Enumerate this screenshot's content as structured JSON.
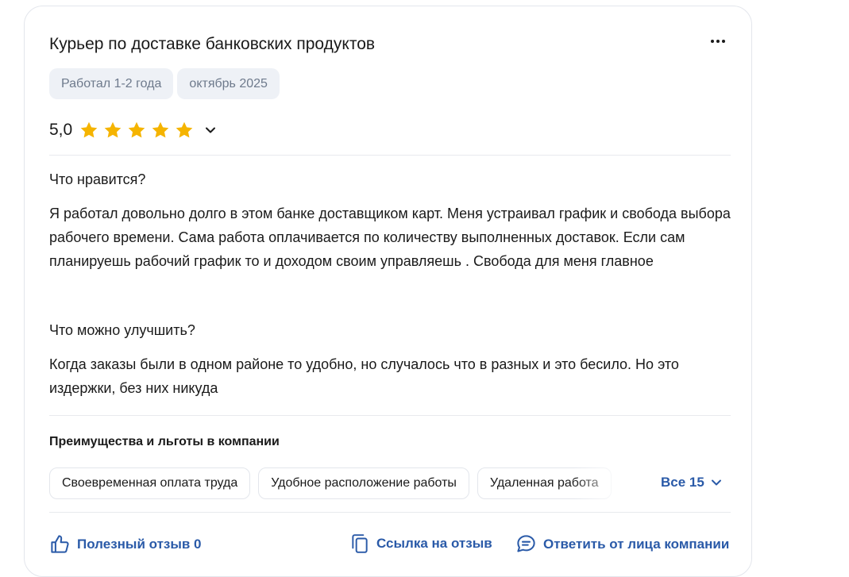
{
  "review": {
    "title": "Курьер по доставке банковских продуктов",
    "tags": [
      "Работал 1-2 года",
      "октябрь 2025"
    ],
    "rating": {
      "value_label": "5,0",
      "stars": 5,
      "star_color": "#f5b400"
    },
    "likes": {
      "heading": "Что нравится?",
      "text": "Я работал довольно долго в этом банке доставщиком карт. Меня устраивал график и свобода выбора рабочего времени. Сама работа оплачивается по количеству выполненных доставок. Если сам планируешь рабочий график то и доходом своим управляешь . Свобода для меня главное"
    },
    "improve": {
      "heading": "Что можно улучшить?",
      "text": "Когда заказы были в одном районе то удобно, но случалось что в разных и это бесило. Но это издержки, без них никуда"
    },
    "benefits": {
      "heading": "Преимущества и льготы в компании",
      "items": [
        "Своевременная оплата труда",
        "Удобное расположение работы",
        "Удаленная работа"
      ],
      "all_label": "Все 15"
    },
    "actions": {
      "helpful_label": "Полезный отзыв 0",
      "link_label": "Ссылка на отзыв",
      "reply_label": "Ответить от лица компании"
    }
  },
  "colors": {
    "accent": "#2a5aa8",
    "tag_bg": "#eef1f6",
    "tag_text": "#6e7a8c",
    "border": "#e3e6ec"
  },
  "icons": [
    "more-icon",
    "star-icon",
    "chevron-down-icon",
    "thumbs-up-icon",
    "copy-icon",
    "chat-icon"
  ]
}
